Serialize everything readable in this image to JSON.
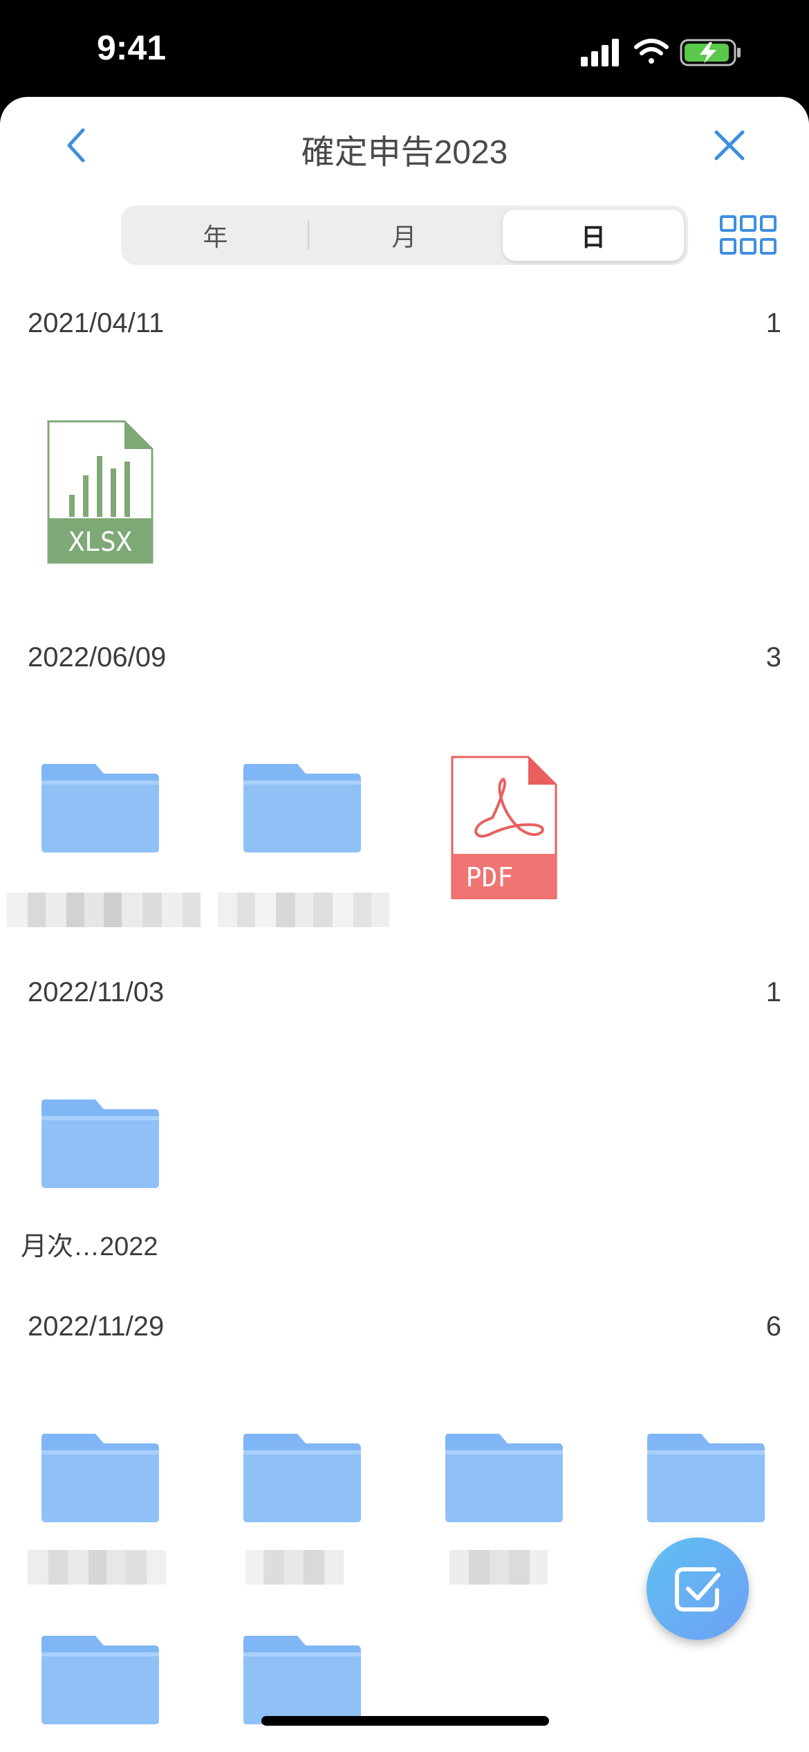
{
  "status_bar": {
    "time": "9:41"
  },
  "header": {
    "title": "確定申告2023"
  },
  "segmented_control": {
    "year_label": "年",
    "month_label": "月",
    "day_label": "日",
    "selected": "日"
  },
  "sections": [
    {
      "date": "2021/04/11",
      "count": "1",
      "items": [
        {
          "type": "xlsx",
          "badge": "XLSX"
        }
      ]
    },
    {
      "date": "2022/06/09",
      "count": "3",
      "items": [
        {
          "type": "folder"
        },
        {
          "type": "folder"
        },
        {
          "type": "pdf",
          "badge": "PDF"
        }
      ]
    },
    {
      "date": "2022/11/03",
      "count": "1",
      "items": [
        {
          "type": "folder",
          "caption": "月次…2022"
        }
      ]
    },
    {
      "date": "2022/11/29",
      "count": "6",
      "items": [
        {
          "type": "folder"
        },
        {
          "type": "folder"
        },
        {
          "type": "folder"
        },
        {
          "type": "folder"
        },
        {
          "type": "folder"
        },
        {
          "type": "folder"
        }
      ]
    }
  ],
  "colors": {
    "accent": "#3d8fe0",
    "folder_light": "#8fc1f7",
    "folder_dark": "#6aa7f3",
    "xlsx_green": "#7fa877",
    "pdf_red": "#e8605e"
  }
}
